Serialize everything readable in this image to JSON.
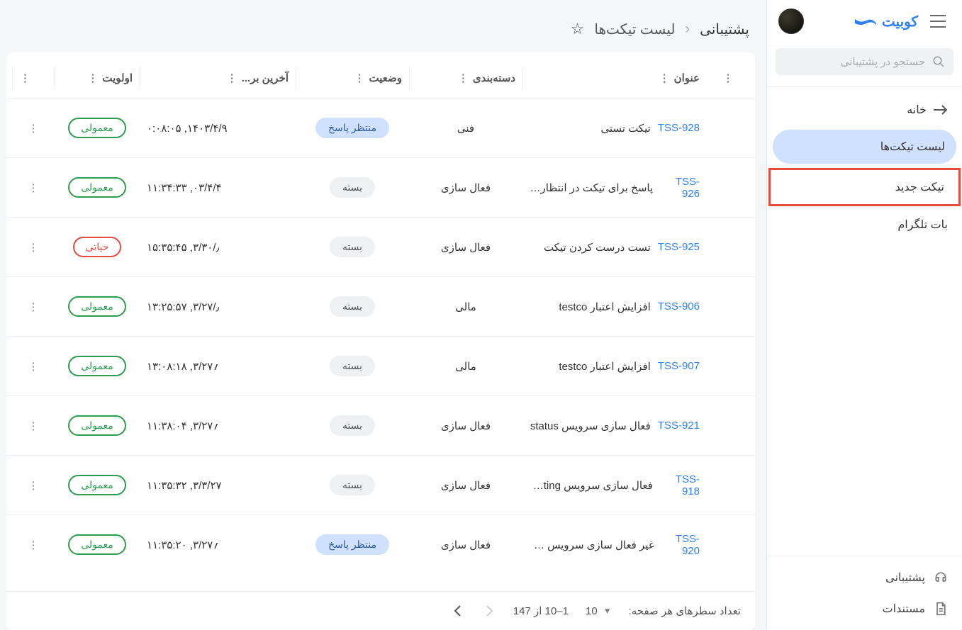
{
  "brand": {
    "name": "کوبیت"
  },
  "search": {
    "placeholder": "جستجو در پشتیبانی"
  },
  "nav": {
    "home": "خانه",
    "tickets": "لیست تیکت‌ها",
    "new_ticket": "تیکت جدید",
    "telegram_bot": "بات تلگرام"
  },
  "footer_nav": {
    "support": "پشتیبانی",
    "docs": "مستندات"
  },
  "breadcrumb": {
    "root": "پشتیبانی",
    "current": "لیست تیکت‌ها"
  },
  "columns": {
    "title": "عنوان",
    "category": "دسته‌بندی",
    "status": "وضعیت",
    "updated": "آخرین بر...",
    "priority": "اولویت"
  },
  "status_labels": {
    "waiting": "منتظر پاسخ",
    "closed": "بسته"
  },
  "priority_labels": {
    "normal": "معمولی",
    "critical": "حیاتی"
  },
  "rows": [
    {
      "id": "TSS-928",
      "title": "تیکت تستی",
      "category": "فنی",
      "status": "waiting",
      "updated": "۱۴۰۳/۴/۹, ۰:۰۸:۰۵",
      "priority": "normal"
    },
    {
      "id": "TSS-926",
      "title": "پاسخ برای تیکت در انتظار م...",
      "category": "فعال سازی",
      "status": "closed",
      "updated": "۰۳/۴/۴, ۱۱:۳۴:۳۳",
      "priority": "normal"
    },
    {
      "id": "TSS-925",
      "title": "تست درست کردن تیکت",
      "category": "فعال سازی",
      "status": "closed",
      "updated": "٫/۳/۳۰, ۱۵:۳۵:۴۵",
      "priority": "critical"
    },
    {
      "id": "TSS-906",
      "title": "افزایش اعتبار testco",
      "category": "مالی",
      "status": "closed",
      "updated": "٫/۳/۲۷, ۱۳:۲۵:۵۷",
      "priority": "normal"
    },
    {
      "id": "TSS-907",
      "title": "افزایش اعتبار testco",
      "category": "مالی",
      "status": "closed",
      "updated": "؍۳/۲۷, ۱۳:۰۸:۱۸",
      "priority": "normal"
    },
    {
      "id": "TSS-921",
      "title": "فعال سازی سرویس status",
      "category": "فعال سازی",
      "status": "closed",
      "updated": "؍۳/۲۷, ۱۱:۳۸:۰۴",
      "priority": "normal"
    },
    {
      "id": "TSS-918",
      "title": "فعال سازی سرویس unting...",
      "category": "فعال سازی",
      "status": "closed",
      "updated": "۳/۳/۲۷, ۱۱:۳۵:۳۲",
      "priority": "normal"
    },
    {
      "id": "TSS-920",
      "title": "غیر فعال سازی سرویس ting...",
      "category": "فعال سازی",
      "status": "waiting",
      "updated": "؍۳/۲۷, ۱۱:۳۵:۲۰",
      "priority": "normal"
    }
  ],
  "pager": {
    "rows_per_page_label": "تعداد سطرهای هر صفحه:",
    "page_size": "10",
    "range": "1–10 از 147"
  }
}
